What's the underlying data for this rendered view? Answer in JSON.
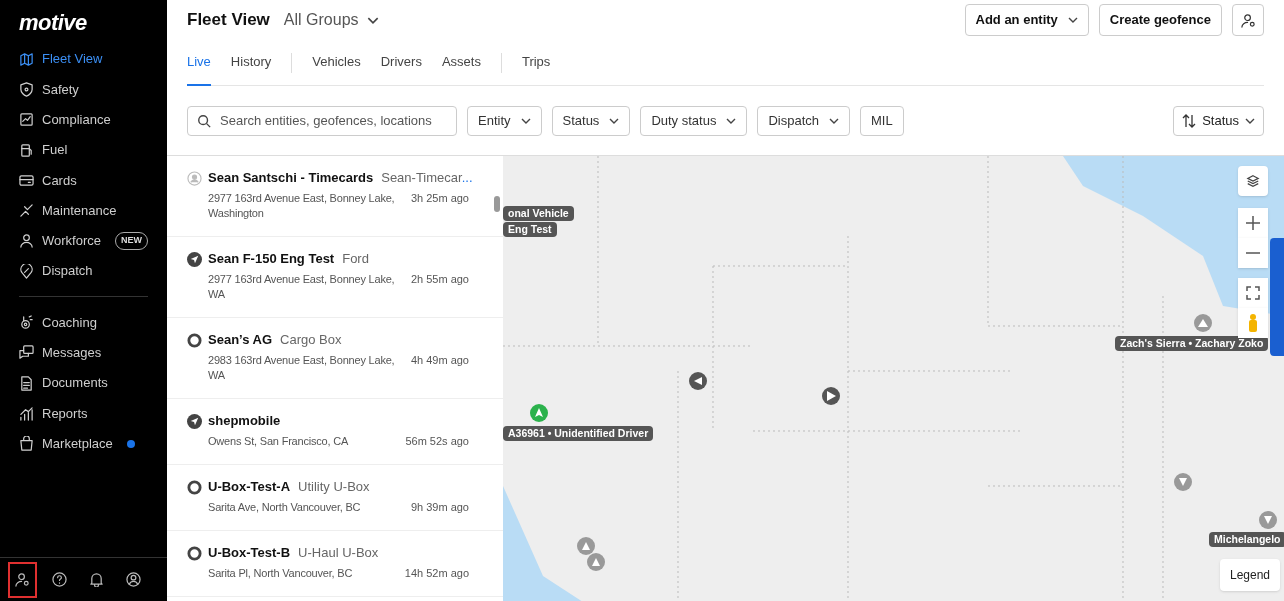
{
  "sidebar": {
    "logo": "motive",
    "groups": [
      [
        {
          "label": "Fleet View",
          "selected": true
        },
        {
          "label": "Safety",
          "selected": false
        },
        {
          "label": "Compliance",
          "selected": false
        },
        {
          "label": "Fuel",
          "selected": false
        },
        {
          "label": "Cards",
          "selected": false
        },
        {
          "label": "Maintenance",
          "selected": false
        },
        {
          "label": "Workforce",
          "selected": false,
          "badge": "NEW"
        },
        {
          "label": "Dispatch",
          "selected": false
        }
      ],
      [
        {
          "label": "Coaching",
          "selected": false
        },
        {
          "label": "Messages",
          "selected": false
        },
        {
          "label": "Documents",
          "selected": false
        },
        {
          "label": "Reports",
          "selected": false
        },
        {
          "label": "Marketplace",
          "selected": false,
          "unread": true
        }
      ]
    ],
    "footer": [
      {
        "highlighted": true
      },
      {
        "highlighted": false
      },
      {
        "highlighted": false
      },
      {
        "highlighted": false
      }
    ]
  },
  "header": {
    "title": "Fleet View",
    "group": "All Groups",
    "buttons": [
      {
        "label": "Add an entity",
        "caret": true
      },
      {
        "label": "Create geofence",
        "caret": false
      }
    ]
  },
  "tab_groups": [
    [
      {
        "label": "Live",
        "selected": true
      },
      {
        "label": "History",
        "selected": false
      }
    ],
    [
      {
        "label": "Vehicles",
        "selected": false
      },
      {
        "label": "Drivers",
        "selected": false
      },
      {
        "label": "Assets",
        "selected": false
      }
    ],
    [
      {
        "label": "Trips",
        "selected": false
      }
    ]
  ],
  "filters": {
    "search_placeholder": "Search entities, geofences, locations",
    "dropdowns": [
      {
        "label": "Entity",
        "caret": true
      },
      {
        "label": "Status",
        "caret": true
      },
      {
        "label": "Duty status",
        "caret": true
      },
      {
        "label": "Dispatch",
        "caret": true
      },
      {
        "label": "MIL",
        "caret": false
      }
    ],
    "sort": "Status"
  },
  "entities": [
    {
      "kind": "person",
      "name": "Sean Santschi - Timecards",
      "type": "Sean-Timecar",
      "type_more": "...",
      "address": "2977 163rd Avenue East, Bonney Lake, Washington",
      "time": "3h 25m ago"
    },
    {
      "kind": "vehicle",
      "name": "Sean F-150 Eng Test",
      "type": "Ford",
      "address": "2977 163rd Avenue East, Bonney Lake, WA",
      "time": "2h 55m ago"
    },
    {
      "kind": "asset",
      "name": "Sean’s AG",
      "type": "Cargo Box",
      "address": "2983 163rd Avenue East, Bonney Lake, WA",
      "time": "4h 49m ago"
    },
    {
      "kind": "vehicle",
      "name": "shepmobile",
      "address": "Owens St, San Francisco, CA",
      "time": "56m 52s ago"
    },
    {
      "kind": "asset",
      "name": "U-Box-Test-A",
      "type": "Utility U-Box",
      "address": "Sarita Ave, North Vancouver, BC",
      "time": "9h 39m ago"
    },
    {
      "kind": "asset",
      "name": "U-Box-Test-B",
      "type": "U-Haul U-Box",
      "address": "Sarita Pl, North Vancouver, BC",
      "time": "14h 52m ago"
    }
  ],
  "map": {
    "labels": [
      "onal Vehicle",
      "Eng Test",
      "A36961 • Unidentified Driver",
      "Zach's Sierra • Zachary Zoko",
      "Michelangelo"
    ],
    "legend": "Legend"
  }
}
